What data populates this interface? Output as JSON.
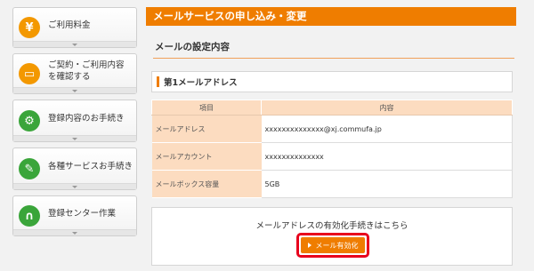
{
  "sidebar": {
    "items": [
      {
        "label": "ご利用料金",
        "icon": "yen-icon",
        "glyph": "¥"
      },
      {
        "label": "ご契約・ご利用内容を確認する",
        "icon": "book-icon",
        "glyph": "▭"
      },
      {
        "label": "登録内容のお手続き",
        "icon": "gear-icon",
        "glyph": "⚙"
      },
      {
        "label": "各種サービスお手続き",
        "icon": "pencil-icon",
        "glyph": "✎"
      },
      {
        "label": "登録センター作業",
        "icon": "headset-icon",
        "glyph": "∩"
      }
    ]
  },
  "main": {
    "header": "メールサービスの申し込み・変更",
    "section_title": "メールの設定内容",
    "address_label": "第1メールアドレス",
    "table": {
      "headers": [
        "項目",
        "内容"
      ],
      "rows": [
        {
          "key": "メールアドレス",
          "value": "xxxxxxxxxxxxxx@xj.commufa.jp"
        },
        {
          "key": "メールアカウント",
          "value": "xxxxxxxxxxxxxx"
        },
        {
          "key": "メールボックス容量",
          "value": "5GB"
        }
      ]
    },
    "activation": {
      "message": "メールアドレスの有効化手続きはこちら",
      "button": "メール有効化"
    }
  },
  "colors": {
    "accent": "#ef7d00",
    "highlight": "#e8001c",
    "table_header": "#fcdcc0"
  }
}
